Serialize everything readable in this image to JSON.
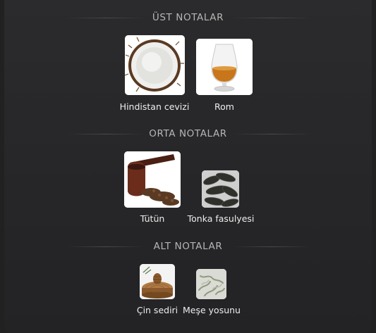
{
  "sections": [
    {
      "title": "ÜST NOTALAR",
      "notes": [
        {
          "label": "Hindistan cevizi",
          "icon": "coconut-image"
        },
        {
          "label": "Rom",
          "icon": "rum-glass-image"
        }
      ]
    },
    {
      "title": "ORTA NOTALAR",
      "notes": [
        {
          "label": "Tütün",
          "icon": "tobacco-pipe-image"
        },
        {
          "label": "Tonka fasulyesi",
          "icon": "tonka-beans-image"
        }
      ]
    },
    {
      "title": "ALT NOTALAR",
      "notes": [
        {
          "label": "Çin sediri",
          "icon": "cedar-wood-image"
        },
        {
          "label": "Meşe yosunu",
          "icon": "oakmoss-image"
        }
      ]
    }
  ],
  "colors": {
    "background": "#212121",
    "panel": "#2a2a2c",
    "title": "#b6b6b6",
    "label": "#eeeeee"
  }
}
